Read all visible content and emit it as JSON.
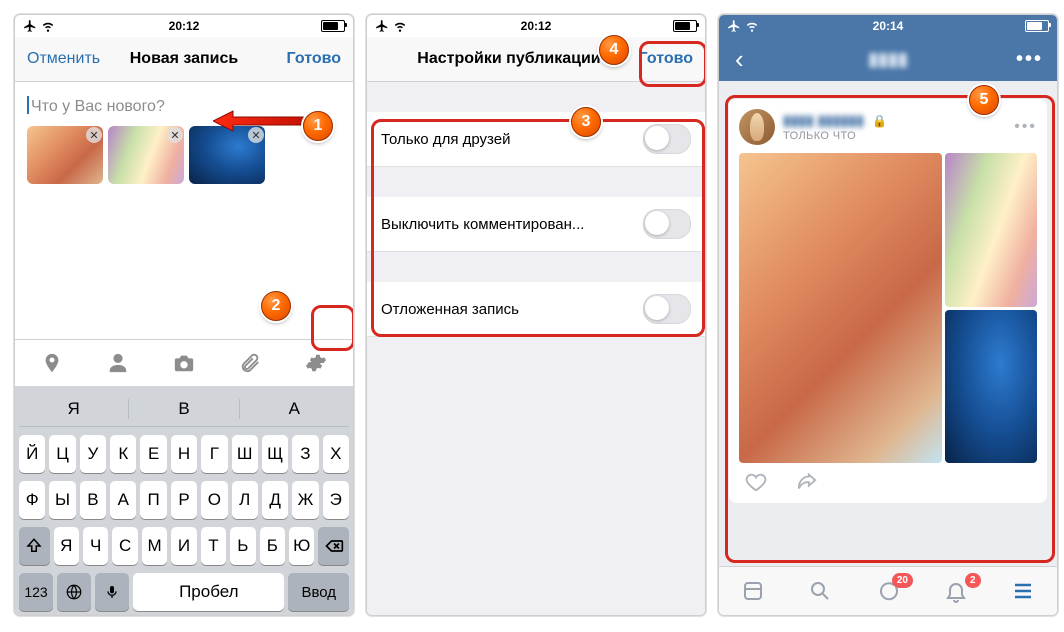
{
  "screen1": {
    "status": {
      "time": "20:12"
    },
    "nav": {
      "cancel": "Отменить",
      "title": "Новая запись",
      "done": "Готово"
    },
    "compose_placeholder": "Что у Вас нового?",
    "keyboard": {
      "suggestions": [
        "Я",
        "В",
        "А"
      ],
      "row1": [
        "Й",
        "Ц",
        "У",
        "К",
        "Е",
        "Н",
        "Г",
        "Ш",
        "Щ",
        "З",
        "Х"
      ],
      "row2": [
        "Ф",
        "Ы",
        "В",
        "А",
        "П",
        "Р",
        "О",
        "Л",
        "Д",
        "Ж",
        "Э"
      ],
      "row3": [
        "Я",
        "Ч",
        "С",
        "М",
        "И",
        "Т",
        "Ь",
        "Б",
        "Ю"
      ],
      "num": "123",
      "space": "Пробел",
      "enter": "Ввод"
    }
  },
  "screen2": {
    "status": {
      "time": "20:12"
    },
    "nav": {
      "title": "Настройки публикации",
      "done": "Готово"
    },
    "rows": {
      "friends_only": "Только для друзей",
      "disable_comments": "Выключить комментирован...",
      "scheduled": "Отложенная запись"
    }
  },
  "screen3": {
    "status": {
      "time": "20:14"
    },
    "post": {
      "time": "ТОЛЬКО ЧТО"
    },
    "badges": {
      "messages": "20",
      "notifications": "2"
    }
  },
  "callouts": {
    "c1": "1",
    "c2": "2",
    "c3": "3",
    "c4": "4",
    "c5": "5"
  }
}
